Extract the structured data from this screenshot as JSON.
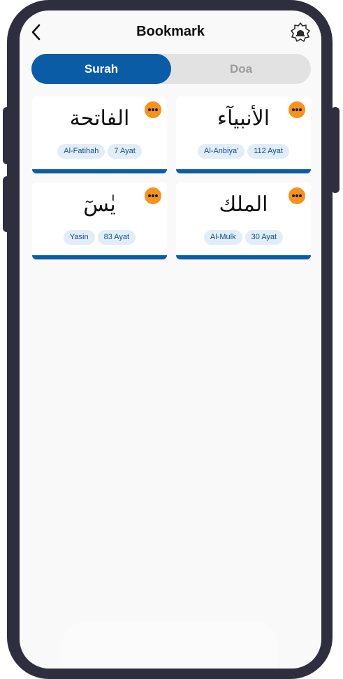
{
  "header": {
    "title": "Bookmark",
    "back_icon": "chevron-left-icon",
    "settings_icon": "mosque-badge-icon"
  },
  "tabs": [
    {
      "label": "Surah",
      "active": true
    },
    {
      "label": "Doa",
      "active": false
    }
  ],
  "bookmarks": [
    {
      "arabic": "الفاتحة",
      "name": "Al-Fatihah",
      "ayat": "7 Ayat"
    },
    {
      "arabic": "الأنبيآء",
      "name": "Al-Anbiya'",
      "ayat": "112 Ayat"
    },
    {
      "arabic": "يٰسٓ",
      "name": "Yasin",
      "ayat": "83 Ayat"
    },
    {
      "arabic": "الملك",
      "name": "Al-Mulk",
      "ayat": "30 Ayat"
    }
  ],
  "colors": {
    "primary": "#0a5ca6",
    "accent": "#f6921e",
    "chip_bg": "#e1edf7",
    "frame": "#2f2e3f"
  }
}
